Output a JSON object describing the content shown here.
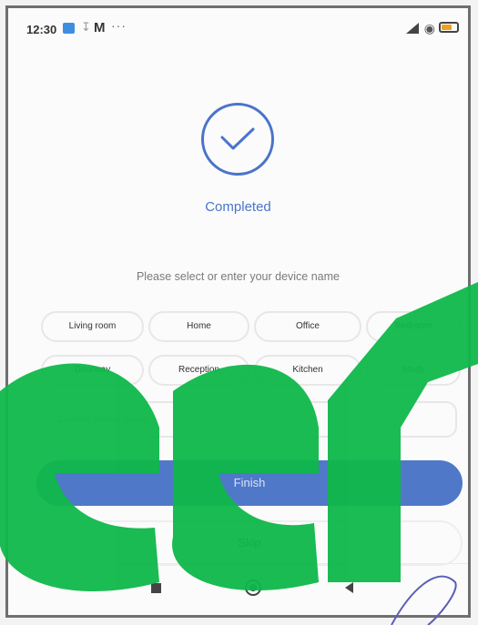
{
  "status_bar": {
    "time": "12:30",
    "more": "···",
    "mail_icon": "M"
  },
  "main": {
    "completed_label": "Completed",
    "prompt": "Please select or enter your device name",
    "rooms": [
      "Living room",
      "Home",
      "Office",
      "Bedroom",
      "Doorway",
      "Reception",
      "Kitchen",
      "Study"
    ],
    "custom_name": {
      "placeholder": "Custom device name",
      "value": ""
    },
    "finish_label": "Finish",
    "skip_label": "Skip"
  },
  "colors": {
    "accent": "#4a74c9",
    "finish_bg": "#4f78c9",
    "watermark": "#0fb84a"
  }
}
